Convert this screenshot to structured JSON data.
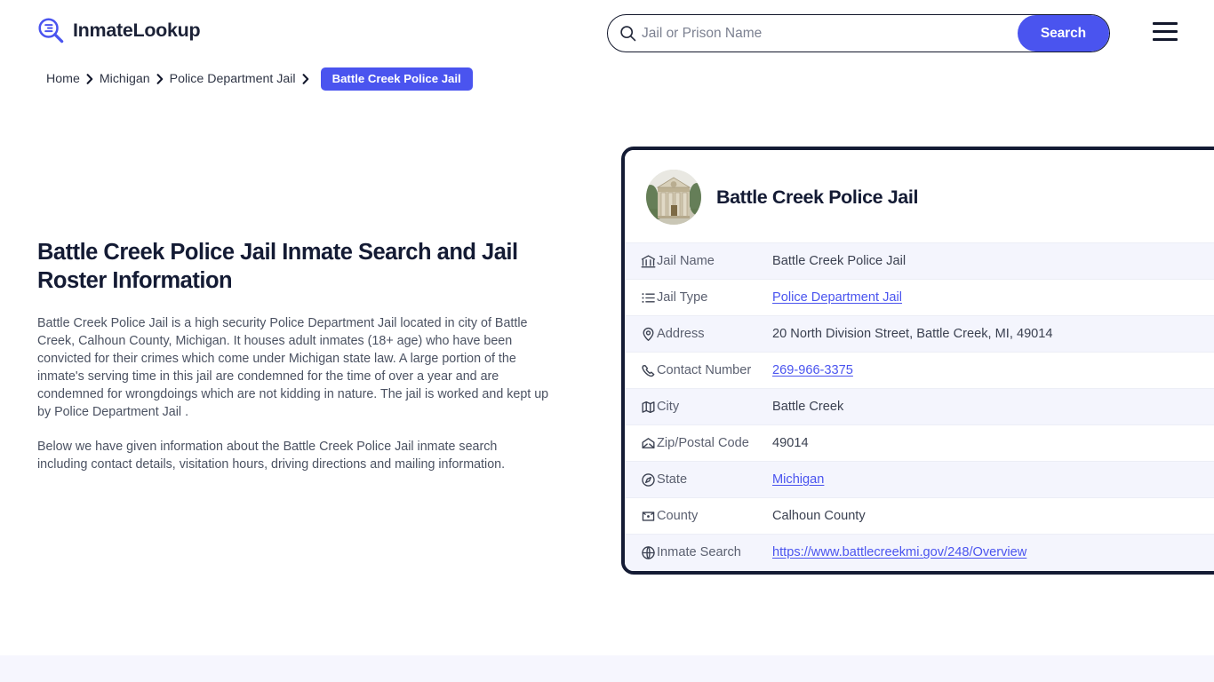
{
  "brand": {
    "name": "InmateLookup",
    "icon": "search-list-logo-icon"
  },
  "search": {
    "placeholder": "Jail or Prison Name",
    "value": "",
    "button_label": "Search",
    "icon": "search-icon"
  },
  "menu": {
    "icon": "hamburger-menu-icon"
  },
  "breadcrumb": {
    "items": [
      {
        "label": "Home"
      },
      {
        "label": "Michigan"
      },
      {
        "label": "Police Department Jail"
      }
    ],
    "current": "Battle Creek Police Jail",
    "separator_icon": "chevron-right-icon"
  },
  "main": {
    "title": "Battle Creek Police Jail Inmate Search and Jail Roster Information",
    "paragraph_1": "Battle Creek Police Jail is a high security Police Department Jail located in city of Battle Creek, Calhoun County, Michigan. It houses adult inmates (18+ age) who have been convicted for their crimes which come under Michigan state law. A large portion of the inmate's serving time in this jail are condemned for the time of over a year and are condemned for wrongdoings which are not kidding in nature. The jail is worked and kept up by Police Department Jail .",
    "paragraph_2": "Below we have given information about the Battle Creek Police Jail inmate search including contact details, visitation hours, driving directions and mailing information."
  },
  "card": {
    "title": "Battle Creek Police Jail",
    "avatar_icon": "courthouse-building-photo",
    "rows": [
      {
        "icon": "bank-icon",
        "label": "Jail Name",
        "value": "Battle Creek Police Jail",
        "link": false
      },
      {
        "icon": "list-icon",
        "label": "Jail Type",
        "value": "Police Department Jail",
        "link": true
      },
      {
        "icon": "map-pin-icon",
        "label": "Address",
        "value": "20 North Division Street, Battle Creek, MI, 49014",
        "link": false
      },
      {
        "icon": "phone-icon",
        "label": "Contact Number",
        "value": "269-966-3375",
        "link": true
      },
      {
        "icon": "map-icon",
        "label": "City",
        "value": "Battle Creek",
        "link": false
      },
      {
        "icon": "envelope-icon",
        "label": "Zip/Postal Code",
        "value": "49014",
        "link": false
      },
      {
        "icon": "compass-icon",
        "label": "State",
        "value": "Michigan",
        "link": true
      },
      {
        "icon": "county-map-icon",
        "label": "County",
        "value": "Calhoun County",
        "link": false
      },
      {
        "icon": "globe-icon",
        "label": "Inmate Search",
        "value": "https://www.battlecreekmi.gov/248/Overview",
        "link": true
      }
    ]
  },
  "colors": {
    "accent": "#4a54ef",
    "dark": "#141b34",
    "row_alt": "#f4f5fd",
    "footer_strip": "#f6f6fe"
  }
}
